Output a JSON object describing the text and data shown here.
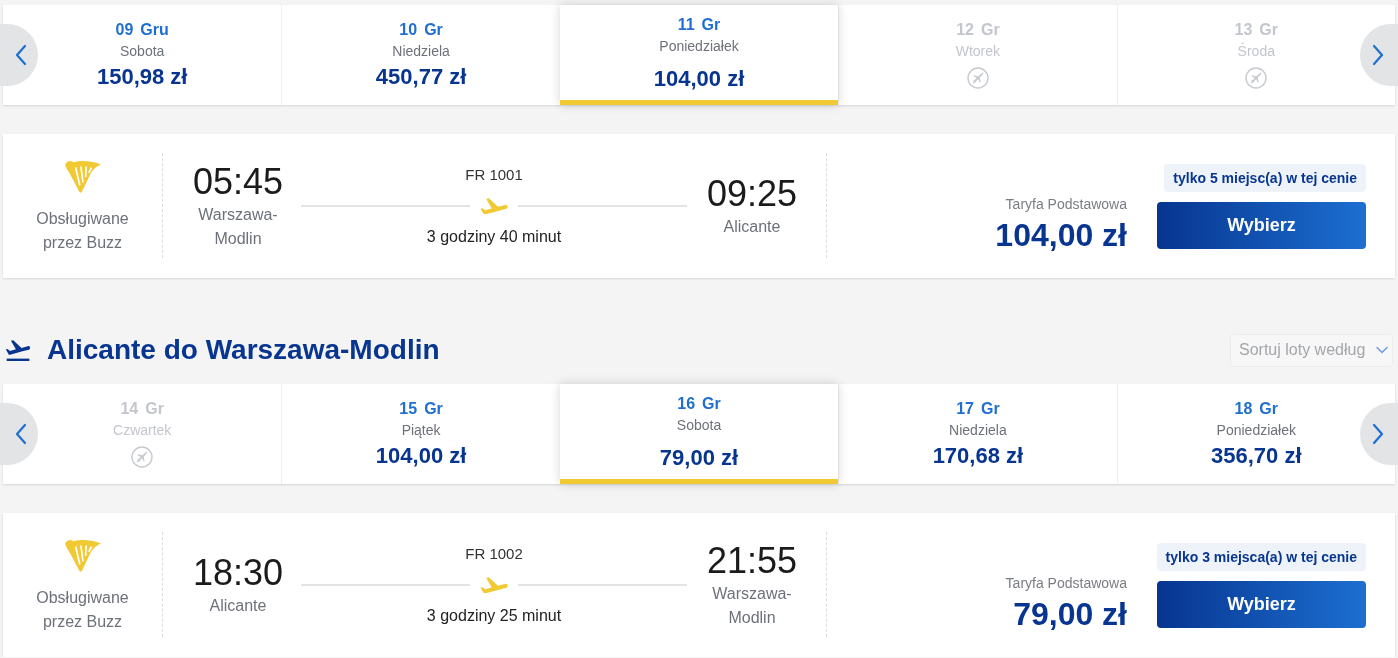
{
  "outbound": {
    "days": [
      {
        "day": "09",
        "month": "Gru",
        "weekday": "Sobota",
        "price": "150,98 zł",
        "available": true,
        "selected": false
      },
      {
        "day": "10",
        "month": "Gr",
        "weekday": "Niedziela",
        "price": "450,77 zł",
        "available": true,
        "selected": false
      },
      {
        "day": "11",
        "month": "Gr",
        "weekday": "Poniedziałek",
        "price": "104,00 zł",
        "available": true,
        "selected": true
      },
      {
        "day": "12",
        "month": "Gr",
        "weekday": "Wtorek",
        "available": false,
        "selected": false
      },
      {
        "day": "13",
        "month": "Gr",
        "weekday": "Środa",
        "available": false,
        "selected": false
      }
    ],
    "flight": {
      "operator": "Obsługiwane przez Buzz",
      "departure_time": "05:45",
      "departure_airport": "Warszawa-Modlin",
      "flight_number": "FR 1001",
      "duration": "3 godziny 40 minut",
      "arrival_time": "09:25",
      "arrival_airport": "Alicante",
      "fare": "Taryfa Podstawowa",
      "price": "104,00 zł",
      "seats_left": "tylko 5 miejsc(a) w tej cenie",
      "button": "Wybierz"
    }
  },
  "return": {
    "heading": "Alicante do Warszawa-Modlin",
    "sort": {
      "placeholder": "Sortuj loty według"
    },
    "days": [
      {
        "day": "14",
        "month": "Gr",
        "weekday": "Czwartek",
        "available": false,
        "selected": false
      },
      {
        "day": "15",
        "month": "Gr",
        "weekday": "Piątek",
        "price": "104,00 zł",
        "available": true,
        "selected": false
      },
      {
        "day": "16",
        "month": "Gr",
        "weekday": "Sobota",
        "price": "79,00 zł",
        "available": true,
        "selected": true
      },
      {
        "day": "17",
        "month": "Gr",
        "weekday": "Niedziela",
        "price": "170,68 zł",
        "available": true,
        "selected": false
      },
      {
        "day": "18",
        "month": "Gr",
        "weekday": "Poniedziałek",
        "price": "356,70 zł",
        "available": true,
        "selected": false
      }
    ],
    "flight": {
      "operator": "Obsługiwane przez Buzz",
      "departure_time": "18:30",
      "departure_airport": "Alicante",
      "flight_number": "FR 1002",
      "duration": "3 godziny 25 minut",
      "arrival_time": "21:55",
      "arrival_airport": "Warszawa-Modlin",
      "fare": "Taryfa Podstawowa",
      "price": "79,00 zł",
      "seats_left": "tylko 3 miejsca(a) w tej cenie",
      "button": "Wybierz"
    }
  }
}
